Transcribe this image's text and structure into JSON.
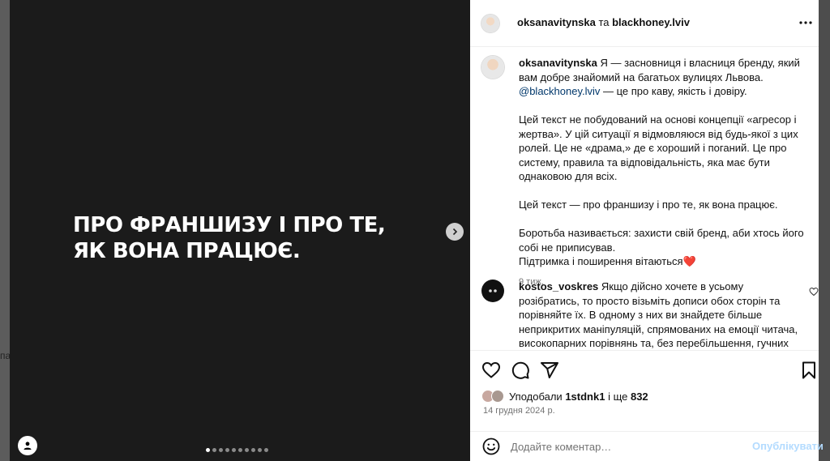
{
  "background": {
    "left_text": "па"
  },
  "media": {
    "slide_lines": [
      "ПРО ФРАНШИЗУ І ПРО ТЕ,",
      "ЯК ВОНА ПРАЦЮЄ."
    ],
    "dot_count": 10,
    "active_dot": 0,
    "next_icon": "chevron-right-icon",
    "tags_icon": "user-icon"
  },
  "header": {
    "author": "oksanavitynska",
    "connector": " та ",
    "coauthor": "blackhoney.lviv",
    "more_icon": "more-horizontal-icon"
  },
  "caption": {
    "author": "oksanavitynska",
    "line1": " Я — засновниця і власниця бренду, який вам добре знайомий на багатьох вулицях Львова.",
    "mention": "@blackhoney.lviv",
    "line1b": " — це про каву, якість і довіру.",
    "para2": "Цей текст не побудований на основі концепції «агресор і жертва». У цій ситуації я відмовляюся від будь-якої з цих ролей. Це не «драма,» де є хороший і поганий. Це про систему, правила та відповідальність, яка має бути однаковою для всіх.",
    "para3": "Цей текст — про франшизу і про те, як вона працює.",
    "para4": "Боротьба називається: захисти свій бренд, аби хтось його собі не приписував.",
    "para5": "Підтримка і поширення вітаються",
    "heart": "❤️",
    "time": "9 тиж."
  },
  "comment": {
    "author": "kostos_voskres",
    "text": " Якщо дійсно хочете в усьому розібратись, то просто візьміть дописи обох сторін та порівняйте їх. В одному з них ви знайдете більше неприкритих маніпуляцій, спрямованих на емоції читача, високопарних порівнянь та, без перебільшення, гучних заяв. А в іншому вам",
    "like_icon": "heart-outline-icon"
  },
  "actions": {
    "icons": [
      "heart-icon",
      "comment-icon",
      "share-icon",
      "bookmark-icon"
    ],
    "likes_prefix": "Уподобали ",
    "likes_user": "1stdnk1",
    "likes_mid": " і ще ",
    "likes_count": "832",
    "date": "14 грудня 2024 р."
  },
  "add_comment": {
    "placeholder": "Додайте коментар…",
    "post_label": "Опублікувати",
    "emoji_icon": "smiley-icon"
  },
  "colors": {
    "media_bg": "#1b1b1b",
    "link": "#00376b",
    "post_btn": "#b3dbff",
    "meta_grey": "#737373"
  }
}
